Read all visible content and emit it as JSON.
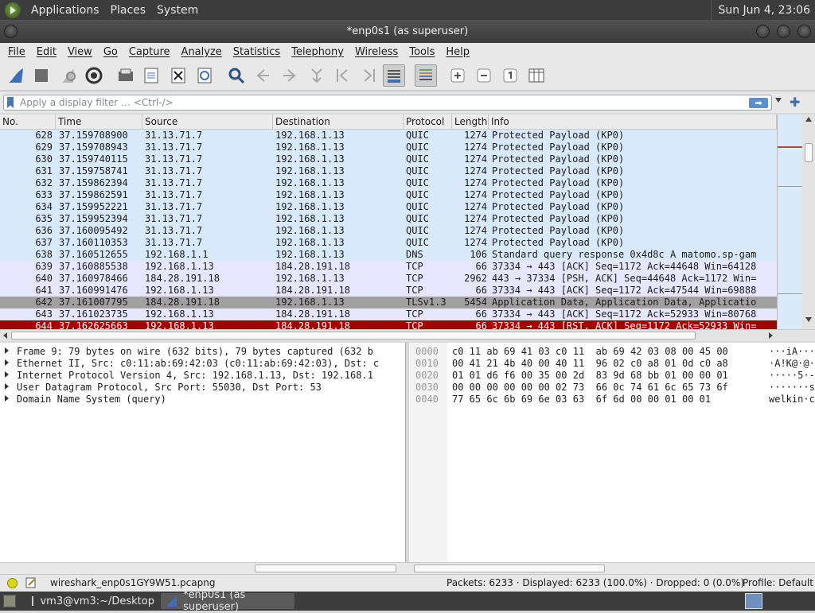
{
  "topbar": {
    "menus": [
      "Applications",
      "Places",
      "System"
    ],
    "clock": "Sun Jun  4, 23:06"
  },
  "window": {
    "title": "*enp0s1 (as superuser)"
  },
  "menubar": [
    "File",
    "Edit",
    "View",
    "Go",
    "Capture",
    "Analyze",
    "Statistics",
    "Telephony",
    "Wireless",
    "Tools",
    "Help"
  ],
  "filter": {
    "placeholder": "Apply a display filter … <Ctrl-/>"
  },
  "columns": [
    "No.",
    "Time",
    "Source",
    "Destination",
    "Protocol",
    "Length",
    "Info"
  ],
  "packets": [
    {
      "no": "628",
      "time": "37.159708900",
      "src": "31.13.71.7",
      "dst": "192.168.1.13",
      "proto": "QUIC",
      "len": "1274",
      "info": "Protected Payload (KP0)",
      "kind": "quic"
    },
    {
      "no": "629",
      "time": "37.159708943",
      "src": "31.13.71.7",
      "dst": "192.168.1.13",
      "proto": "QUIC",
      "len": "1274",
      "info": "Protected Payload (KP0)",
      "kind": "quic"
    },
    {
      "no": "630",
      "time": "37.159740115",
      "src": "31.13.71.7",
      "dst": "192.168.1.13",
      "proto": "QUIC",
      "len": "1274",
      "info": "Protected Payload (KP0)",
      "kind": "quic"
    },
    {
      "no": "631",
      "time": "37.159758741",
      "src": "31.13.71.7",
      "dst": "192.168.1.13",
      "proto": "QUIC",
      "len": "1274",
      "info": "Protected Payload (KP0)",
      "kind": "quic"
    },
    {
      "no": "632",
      "time": "37.159862394",
      "src": "31.13.71.7",
      "dst": "192.168.1.13",
      "proto": "QUIC",
      "len": "1274",
      "info": "Protected Payload (KP0)",
      "kind": "quic"
    },
    {
      "no": "633",
      "time": "37.159862591",
      "src": "31.13.71.7",
      "dst": "192.168.1.13",
      "proto": "QUIC",
      "len": "1274",
      "info": "Protected Payload (KP0)",
      "kind": "quic"
    },
    {
      "no": "634",
      "time": "37.159952221",
      "src": "31.13.71.7",
      "dst": "192.168.1.13",
      "proto": "QUIC",
      "len": "1274",
      "info": "Protected Payload (KP0)",
      "kind": "quic"
    },
    {
      "no": "635",
      "time": "37.159952394",
      "src": "31.13.71.7",
      "dst": "192.168.1.13",
      "proto": "QUIC",
      "len": "1274",
      "info": "Protected Payload (KP0)",
      "kind": "quic"
    },
    {
      "no": "636",
      "time": "37.160095492",
      "src": "31.13.71.7",
      "dst": "192.168.1.13",
      "proto": "QUIC",
      "len": "1274",
      "info": "Protected Payload (KP0)",
      "kind": "quic"
    },
    {
      "no": "637",
      "time": "37.160110353",
      "src": "31.13.71.7",
      "dst": "192.168.1.13",
      "proto": "QUIC",
      "len": "1274",
      "info": "Protected Payload (KP0)",
      "kind": "quic"
    },
    {
      "no": "638",
      "time": "37.160512655",
      "src": "192.168.1.1",
      "dst": "192.168.1.13",
      "proto": "DNS",
      "len": "106",
      "info": "Standard query response 0x4d8c A matomo.sp-gam",
      "kind": "quic"
    },
    {
      "no": "639",
      "time": "37.160885538",
      "src": "192.168.1.13",
      "dst": "184.28.191.18",
      "proto": "TCP",
      "len": "66",
      "info": "37334 → 443 [ACK] Seq=1172 Ack=44648 Win=64128",
      "kind": "tcp"
    },
    {
      "no": "640",
      "time": "37.160978466",
      "src": "184.28.191.18",
      "dst": "192.168.1.13",
      "proto": "TCP",
      "len": "2962",
      "info": "443 → 37334 [PSH, ACK] Seq=44648 Ack=1172 Win=",
      "kind": "tcp"
    },
    {
      "no": "641",
      "time": "37.160991476",
      "src": "192.168.1.13",
      "dst": "184.28.191.18",
      "proto": "TCP",
      "len": "66",
      "info": "37334 → 443 [ACK] Seq=1172 Ack=47544 Win=69888",
      "kind": "tcp"
    },
    {
      "no": "642",
      "time": "37.161007795",
      "src": "184.28.191.18",
      "dst": "192.168.1.13",
      "proto": "TLSv1.3",
      "len": "5454",
      "info": "Application Data, Application Data, Applicatio",
      "kind": "sel"
    },
    {
      "no": "643",
      "time": "37.161023735",
      "src": "192.168.1.13",
      "dst": "184.28.191.18",
      "proto": "TCP",
      "len": "66",
      "info": "37334 → 443 [ACK] Seq=1172 Ack=52933 Win=80768",
      "kind": "tcp"
    },
    {
      "no": "644",
      "time": "37.162625663",
      "src": "192.168.1.13",
      "dst": "184.28.191.18",
      "proto": "TCP",
      "len": "66",
      "info": "37334 → 443 [RST, ACK] Seq=1172 Ack=52933 Win=",
      "kind": "rst"
    }
  ],
  "details": [
    "Frame 9: 79 bytes on wire (632 bits), 79 bytes captured (632 b",
    "Ethernet II, Src: c0:11:ab:69:42:03 (c0:11:ab:69:42:03), Dst: c",
    "Internet Protocol Version 4, Src: 192.168.1.13, Dst: 192.168.1",
    "User Datagram Protocol, Src Port: 55030, Dst Port: 53",
    "Domain Name System (query)"
  ],
  "bytes": [
    {
      "off": "0000",
      "hex": "c0 11 ab 69 41 03 c0 11  ab 69 42 03 08 00 45 00",
      "ascii": "···iA···"
    },
    {
      "off": "0010",
      "hex": "00 41 21 4b 40 00 40 11  96 02 c0 a8 01 0d c0 a8",
      "ascii": "·A!K@·@·"
    },
    {
      "off": "0020",
      "hex": "01 01 d6 f6 00 35 00 2d  83 9d 68 bb 01 00 00 01",
      "ascii": "·····5·-"
    },
    {
      "off": "0030",
      "hex": "00 00 00 00 00 00 02 73  66 0c 74 61 6c 65 73 6f",
      "ascii": "·······s"
    },
    {
      "off": "0040",
      "hex": "77 65 6c 6b 69 6e 03 63  6f 6d 00 00 01 00 01",
      "ascii": "welkin·c"
    }
  ],
  "status": {
    "file": "wireshark_enp0s1GY9W51.pcapng",
    "counts": "Packets: 6233 · Displayed: 6233 (100.0%) · Dropped: 0 (0.0%)",
    "profile": "Profile: Default"
  },
  "taskbar": {
    "items": [
      "vm3@vm3:~/Desktop",
      "*enp0s1 (as superuser)"
    ]
  }
}
